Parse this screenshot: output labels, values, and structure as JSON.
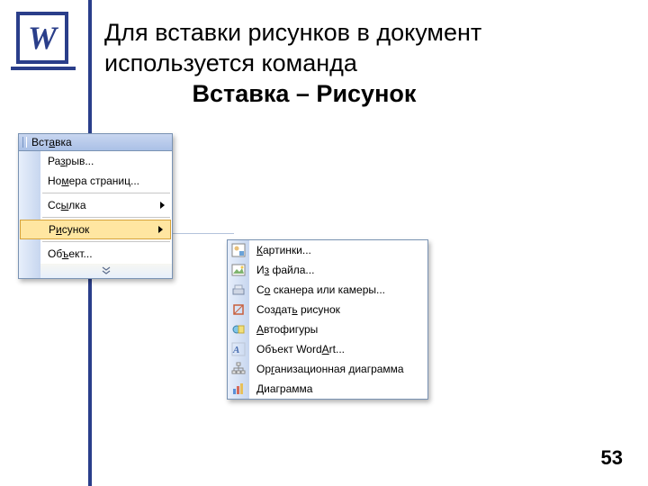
{
  "logo_letter": "W",
  "title_line1": "Для вставки рисунков в документ используется команда",
  "title_line2": "Вставка – Рисунок",
  "page_number": "53",
  "menu1": {
    "title": "Вставка",
    "title_hotkey": "а",
    "items": [
      {
        "label": "Разрыв...",
        "hot": "з",
        "submenu": false
      },
      {
        "label": "Номера страниц...",
        "hot": "м",
        "submenu": false
      },
      {
        "label": "Ссылка",
        "hot": "ы",
        "submenu": true,
        "sep_before": true
      },
      {
        "label": "Рисунок",
        "hot": "и",
        "submenu": true,
        "selected": true,
        "sep_before": true
      },
      {
        "label": "Объект...",
        "hot": "ъ",
        "submenu": false,
        "sep_before": true
      }
    ]
  },
  "menu2": {
    "items": [
      {
        "label": "Картинки...",
        "hot": "К",
        "icon": "clipart-icon"
      },
      {
        "label": "Из файла...",
        "hot": "з",
        "icon": "from-file-icon"
      },
      {
        "label": "Со сканера или камеры...",
        "hot": "о",
        "icon": "scanner-icon"
      },
      {
        "label": "Создать рисунок",
        "hot": "ь",
        "icon": "new-drawing-icon"
      },
      {
        "label": "Автофигуры",
        "hot": "А",
        "icon": "autoshapes-icon"
      },
      {
        "label": "Объект WordArt...",
        "hot": "A",
        "icon": "wordart-icon"
      },
      {
        "label": "Организационная диаграмма",
        "hot": "г",
        "icon": "orgchart-icon"
      },
      {
        "label": "Диаграмма",
        "hot": "Д",
        "icon": "chart-icon"
      }
    ]
  }
}
